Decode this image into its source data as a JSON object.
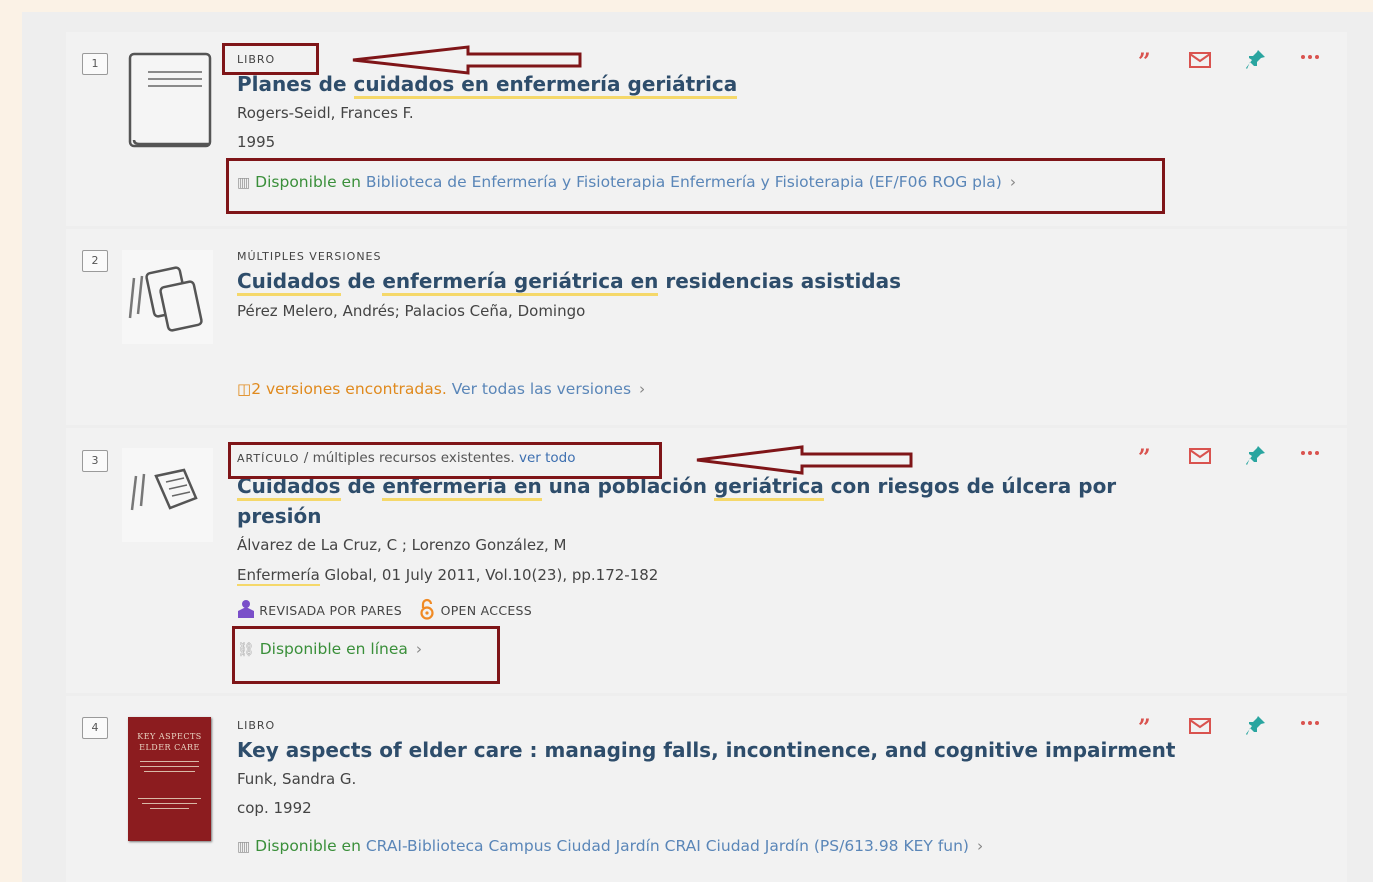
{
  "results": [
    {
      "number": "1",
      "type": "LIBRO",
      "title_parts": [
        "Planes de ",
        "cuidados en enfermería geriátrica"
      ],
      "author": "Rogers-Seidl, Frances F.",
      "date": "1995",
      "avail_status": "Disponible en",
      "avail_location": " Biblioteca de Enfermería y Fisioterapia  Enfermería y Fisioterapia (EF/F06 ROG pla)",
      "chevron": "›"
    },
    {
      "number": "2",
      "type": "MÚLTIPLES VERSIONES",
      "title_parts": [
        "Cuidados",
        " de ",
        "enfermería geriátrica en",
        " residencias asistidas"
      ],
      "author": "Pérez Melero, Andrés; Palacios Ceña, Domingo",
      "versions_count": "2 versiones encontradas.",
      "versions_link": " Ver todas las versiones",
      "chevron": "›"
    },
    {
      "number": "3",
      "type_cap": "ARTÍCULO",
      "type_rest": " / múltiples recursos existentes. ",
      "type_link": "ver todo",
      "title_line1_parts": [
        "Cuidados",
        " de ",
        "enfermería en",
        " una población ",
        "geriátrica",
        " con riesgos de úlcera por"
      ],
      "title_line2": "presión",
      "author": "Álvarez de La Cruz, C ; Lorenzo González, M",
      "source_hl": "Enfermería",
      "source_rest": " Global, 01 July 2011, Vol.10(23), pp.172-182",
      "badge_peer": "REVISADA POR PARES",
      "badge_open": "OPEN ACCESS",
      "avail_status": "Disponible en línea",
      "chevron": "›"
    },
    {
      "number": "4",
      "type": "LIBRO",
      "title": "Key aspects of elder care : managing falls, incontinence, and cognitive impairment",
      "author": "Funk, Sandra G.",
      "date": "cop. 1992",
      "avail_status": "Disponible en",
      "avail_location": " CRAI-Biblioteca Campus Ciudad Jardín  CRAI Ciudad Jardín (PS/613.98 KEY fun)",
      "chevron": "›",
      "cover_title": "KEY ASPECTS ELDER CARE"
    }
  ],
  "action_icons": [
    "citation-icon",
    "email-icon",
    "pin-icon",
    "more-icon"
  ],
  "colors": {
    "annotation_red": "#7f1518",
    "title_blue": "#2e4d6b",
    "available_green": "#3a8f3a",
    "link_blue": "#5a86b8",
    "highlight_yellow": "#f5d86a",
    "citation_red": "#d9534f",
    "pin_teal": "#2aa5a0"
  }
}
